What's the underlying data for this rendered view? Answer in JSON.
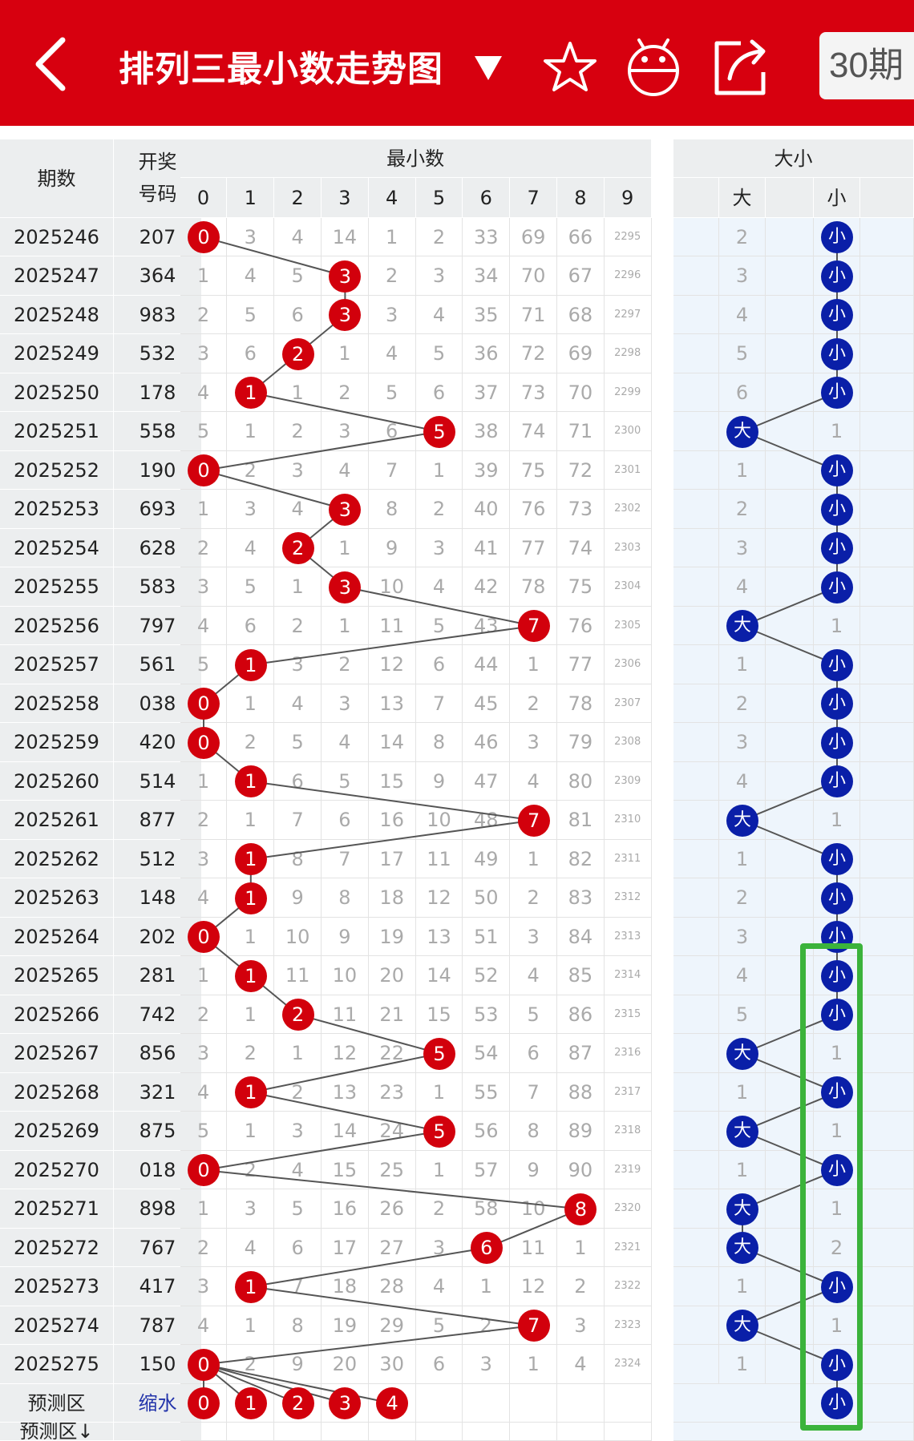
{
  "header": {
    "title": "排列三最小数走势图",
    "period_button": "30期",
    "icons": [
      "back-arrow-icon",
      "dropdown-triangle-icon",
      "star-icon",
      "android-icon",
      "share-icon"
    ]
  },
  "table": {
    "col_issue": "期数",
    "col_number_line1": "开奖",
    "col_number_line2": "号码",
    "group_min": "最小数",
    "group_size": "大小",
    "min_digits": [
      "0",
      "1",
      "2",
      "3",
      "4",
      "5",
      "6",
      "7",
      "8",
      "9"
    ],
    "size_labels": [
      "大",
      "小"
    ],
    "rows": [
      {
        "issue": "2025246",
        "num": "207",
        "min": 0,
        "miss": [
          "",
          "3",
          "4",
          "14",
          "1",
          "2",
          "33",
          "69",
          "66",
          "2295"
        ],
        "size": "小",
        "bigmiss": "2",
        "smallmiss": ""
      },
      {
        "issue": "2025247",
        "num": "364",
        "min": 3,
        "miss": [
          "1",
          "4",
          "5",
          "",
          "2",
          "3",
          "34",
          "70",
          "67",
          "2296"
        ],
        "size": "小",
        "bigmiss": "3",
        "smallmiss": ""
      },
      {
        "issue": "2025248",
        "num": "983",
        "min": 3,
        "miss": [
          "2",
          "5",
          "6",
          "",
          "3",
          "4",
          "35",
          "71",
          "68",
          "2297"
        ],
        "size": "小",
        "bigmiss": "4",
        "smallmiss": ""
      },
      {
        "issue": "2025249",
        "num": "532",
        "min": 2,
        "miss": [
          "3",
          "6",
          "",
          "1",
          "4",
          "5",
          "36",
          "72",
          "69",
          "2298"
        ],
        "size": "小",
        "bigmiss": "5",
        "smallmiss": ""
      },
      {
        "issue": "2025250",
        "num": "178",
        "min": 1,
        "miss": [
          "4",
          "",
          "1",
          "2",
          "5",
          "6",
          "37",
          "73",
          "70",
          "2299"
        ],
        "size": "小",
        "bigmiss": "6",
        "smallmiss": ""
      },
      {
        "issue": "2025251",
        "num": "558",
        "min": 5,
        "miss": [
          "5",
          "1",
          "2",
          "3",
          "6",
          "",
          "38",
          "74",
          "71",
          "2300"
        ],
        "size": "大",
        "bigmiss": "",
        "smallmiss": "1"
      },
      {
        "issue": "2025252",
        "num": "190",
        "min": 0,
        "miss": [
          "",
          "2",
          "3",
          "4",
          "7",
          "1",
          "39",
          "75",
          "72",
          "2301"
        ],
        "size": "小",
        "bigmiss": "1",
        "smallmiss": ""
      },
      {
        "issue": "2025253",
        "num": "693",
        "min": 3,
        "miss": [
          "1",
          "3",
          "4",
          "",
          "8",
          "2",
          "40",
          "76",
          "73",
          "2302"
        ],
        "size": "小",
        "bigmiss": "2",
        "smallmiss": ""
      },
      {
        "issue": "2025254",
        "num": "628",
        "min": 2,
        "miss": [
          "2",
          "4",
          "",
          "1",
          "9",
          "3",
          "41",
          "77",
          "74",
          "2303"
        ],
        "size": "小",
        "bigmiss": "3",
        "smallmiss": ""
      },
      {
        "issue": "2025255",
        "num": "583",
        "min": 3,
        "miss": [
          "3",
          "5",
          "1",
          "",
          "10",
          "4",
          "42",
          "78",
          "75",
          "2304"
        ],
        "size": "小",
        "bigmiss": "4",
        "smallmiss": ""
      },
      {
        "issue": "2025256",
        "num": "797",
        "min": 7,
        "miss": [
          "4",
          "6",
          "2",
          "1",
          "11",
          "5",
          "43",
          "",
          "76",
          "2305"
        ],
        "size": "大",
        "bigmiss": "",
        "smallmiss": "1"
      },
      {
        "issue": "2025257",
        "num": "561",
        "min": 1,
        "miss": [
          "5",
          "",
          "3",
          "2",
          "12",
          "6",
          "44",
          "1",
          "77",
          "2306"
        ],
        "size": "小",
        "bigmiss": "1",
        "smallmiss": ""
      },
      {
        "issue": "2025258",
        "num": "038",
        "min": 0,
        "miss": [
          "",
          "1",
          "4",
          "3",
          "13",
          "7",
          "45",
          "2",
          "78",
          "2307"
        ],
        "size": "小",
        "bigmiss": "2",
        "smallmiss": ""
      },
      {
        "issue": "2025259",
        "num": "420",
        "min": 0,
        "miss": [
          "",
          "2",
          "5",
          "4",
          "14",
          "8",
          "46",
          "3",
          "79",
          "2308"
        ],
        "size": "小",
        "bigmiss": "3",
        "smallmiss": ""
      },
      {
        "issue": "2025260",
        "num": "514",
        "min": 1,
        "miss": [
          "1",
          "",
          "6",
          "5",
          "15",
          "9",
          "47",
          "4",
          "80",
          "2309"
        ],
        "size": "小",
        "bigmiss": "4",
        "smallmiss": ""
      },
      {
        "issue": "2025261",
        "num": "877",
        "min": 7,
        "miss": [
          "2",
          "1",
          "7",
          "6",
          "16",
          "10",
          "48",
          "",
          "81",
          "2310"
        ],
        "size": "大",
        "bigmiss": "",
        "smallmiss": "1"
      },
      {
        "issue": "2025262",
        "num": "512",
        "min": 1,
        "miss": [
          "3",
          "",
          "8",
          "7",
          "17",
          "11",
          "49",
          "1",
          "82",
          "2311"
        ],
        "size": "小",
        "bigmiss": "1",
        "smallmiss": ""
      },
      {
        "issue": "2025263",
        "num": "148",
        "min": 1,
        "miss": [
          "4",
          "",
          "9",
          "8",
          "18",
          "12",
          "50",
          "2",
          "83",
          "2312"
        ],
        "size": "小",
        "bigmiss": "2",
        "smallmiss": ""
      },
      {
        "issue": "2025264",
        "num": "202",
        "min": 0,
        "miss": [
          "",
          "1",
          "10",
          "9",
          "19",
          "13",
          "51",
          "3",
          "84",
          "2313"
        ],
        "size": "小",
        "bigmiss": "3",
        "smallmiss": ""
      },
      {
        "issue": "2025265",
        "num": "281",
        "min": 1,
        "miss": [
          "1",
          "",
          "11",
          "10",
          "20",
          "14",
          "52",
          "4",
          "85",
          "2314"
        ],
        "size": "小",
        "bigmiss": "4",
        "smallmiss": ""
      },
      {
        "issue": "2025266",
        "num": "742",
        "min": 2,
        "miss": [
          "2",
          "1",
          "",
          "11",
          "21",
          "15",
          "53",
          "5",
          "86",
          "2315"
        ],
        "size": "小",
        "bigmiss": "5",
        "smallmiss": ""
      },
      {
        "issue": "2025267",
        "num": "856",
        "min": 5,
        "miss": [
          "3",
          "2",
          "1",
          "12",
          "22",
          "",
          "54",
          "6",
          "87",
          "2316"
        ],
        "size": "大",
        "bigmiss": "",
        "smallmiss": "1"
      },
      {
        "issue": "2025268",
        "num": "321",
        "min": 1,
        "miss": [
          "4",
          "",
          "2",
          "13",
          "23",
          "1",
          "55",
          "7",
          "88",
          "2317"
        ],
        "size": "小",
        "bigmiss": "1",
        "smallmiss": ""
      },
      {
        "issue": "2025269",
        "num": "875",
        "min": 5,
        "miss": [
          "5",
          "1",
          "3",
          "14",
          "24",
          "",
          "56",
          "8",
          "89",
          "2318"
        ],
        "size": "大",
        "bigmiss": "",
        "smallmiss": "1"
      },
      {
        "issue": "2025270",
        "num": "018",
        "min": 0,
        "miss": [
          "",
          "2",
          "4",
          "15",
          "25",
          "1",
          "57",
          "9",
          "90",
          "2319"
        ],
        "size": "小",
        "bigmiss": "1",
        "smallmiss": ""
      },
      {
        "issue": "2025271",
        "num": "898",
        "min": 8,
        "miss": [
          "1",
          "3",
          "5",
          "16",
          "26",
          "2",
          "58",
          "10",
          "",
          "2320"
        ],
        "size": "大",
        "bigmiss": "",
        "smallmiss": "1"
      },
      {
        "issue": "2025272",
        "num": "767",
        "min": 6,
        "miss": [
          "2",
          "4",
          "6",
          "17",
          "27",
          "3",
          "",
          "11",
          "1",
          "2321"
        ],
        "size": "大",
        "bigmiss": "",
        "smallmiss": "2"
      },
      {
        "issue": "2025273",
        "num": "417",
        "min": 1,
        "miss": [
          "3",
          "",
          "7",
          "18",
          "28",
          "4",
          "1",
          "12",
          "2",
          "2322"
        ],
        "size": "小",
        "bigmiss": "1",
        "smallmiss": ""
      },
      {
        "issue": "2025274",
        "num": "787",
        "min": 7,
        "miss": [
          "4",
          "1",
          "8",
          "19",
          "29",
          "5",
          "2",
          "",
          "3",
          "2323"
        ],
        "size": "大",
        "bigmiss": "",
        "smallmiss": "1"
      },
      {
        "issue": "2025275",
        "num": "150",
        "min": 0,
        "miss": [
          "",
          "2",
          "9",
          "20",
          "30",
          "6",
          "3",
          "1",
          "4",
          "2324"
        ],
        "size": "小",
        "bigmiss": "1",
        "smallmiss": ""
      }
    ],
    "predict": {
      "label": "预测区",
      "sub_label": "缩水",
      "balls": [
        "0",
        "1",
        "2",
        "3",
        "4"
      ],
      "size_ball": "小",
      "footer_label": "预测区↓"
    }
  },
  "colors": {
    "header_red": "#d7000f",
    "ball_red": "#d2000c",
    "ball_blue": "#0a1fa8",
    "highlight_green": "#3bb33b",
    "cell_grey": "#eceeef"
  }
}
